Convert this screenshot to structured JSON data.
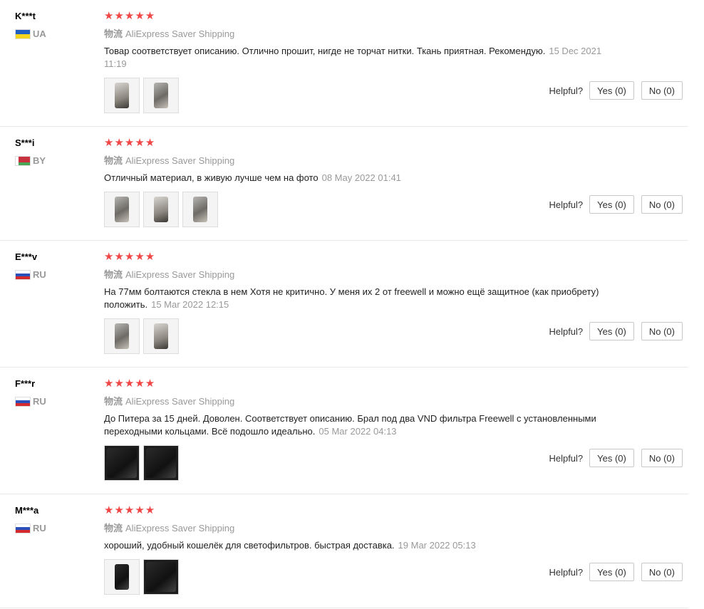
{
  "helpful_label": "Helpful?",
  "star_color": "#f04646",
  "reviews": [
    {
      "user": "K***t",
      "country": "UA",
      "stars": "★★★★★",
      "rating": 5,
      "shipping_cn": "物流",
      "shipping": "AliExpress Saver Shipping",
      "text": "Товар соответствует описанию. Отлично прошит, нигде не торчат нитки. Ткань приятная. Рекомендую.",
      "date": "15 Dec 2021 11:19",
      "yes": "Yes (0)",
      "no": "No (0)"
    },
    {
      "user": "S***i",
      "country": "BY",
      "stars": "★★★★★",
      "rating": 5,
      "shipping_cn": "物流",
      "shipping": "AliExpress Saver Shipping",
      "text": "Отличный материал, в живую лучше чем на фото",
      "date": "08 May 2022 01:41",
      "yes": "Yes (0)",
      "no": "No (0)"
    },
    {
      "user": "E***v",
      "country": "RU",
      "stars": "★★★★★",
      "rating": 5,
      "shipping_cn": "物流",
      "shipping": "AliExpress Saver Shipping",
      "text": "На 77мм болтаются стекла в нем Хотя не критично. У меня их 2 от freewell и можно ещё защитное (как приобрету) положить.",
      "date": "15 Mar 2022 12:15",
      "yes": "Yes (0)",
      "no": "No (0)"
    },
    {
      "user": "F***r",
      "country": "RU",
      "stars": "★★★★★",
      "rating": 5,
      "shipping_cn": "物流",
      "shipping": "AliExpress Saver Shipping",
      "text": "До Питера за 15 дней. Доволен. Соответствует описанию. Брал под два VND фильтра Freewell с установленными переходными кольцами. Всё подошло идеально.",
      "date": "05 Mar 2022 04:13",
      "yes": "Yes (0)",
      "no": "No (0)"
    },
    {
      "user": "M***a",
      "country": "RU",
      "stars": "★★★★★",
      "rating": 5,
      "shipping_cn": "物流",
      "shipping": "AliExpress Saver Shipping",
      "text": "хороший, удобный кошелёк для светофильтров. быстрая доставка.",
      "date": "19 Mar 2022 05:13",
      "yes": "Yes (0)",
      "no": "No (0)"
    }
  ]
}
